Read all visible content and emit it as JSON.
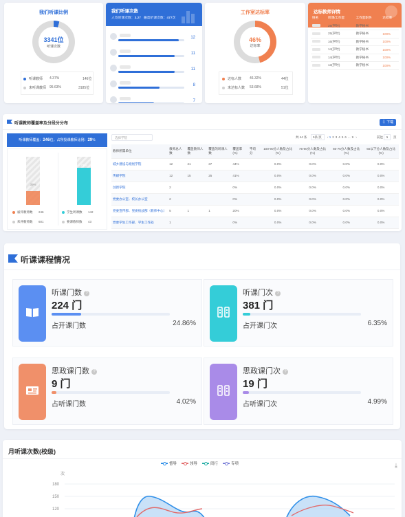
{
  "panel1": {
    "title": "我们听课比例",
    "donut_value": "3341位",
    "donut_sub": "听课次数",
    "legend": [
      {
        "label": "听课教师",
        "pct": "4.37%",
        "count": "146位",
        "color": "#2f6fd8"
      },
      {
        "label": "未听课教师",
        "pct": "95.63%",
        "count": "3185位",
        "color": "#cfcfcf"
      }
    ],
    "ratio": 0.0437
  },
  "panel2": {
    "title": "我们听课次数",
    "sub_prefix": "人均听课次数：",
    "sub_value": "3.27",
    "sub2_prefix": "最高听课次数：",
    "sub2_value": "477",
    "sub2_unit": "次",
    "rows": [
      {
        "value": "12",
        "fraction": 0.92
      },
      {
        "value": "11",
        "fraction": 0.85
      },
      {
        "value": "11",
        "fraction": 0.85
      },
      {
        "value": "8",
        "fraction": 0.62
      },
      {
        "value": "7",
        "fraction": 0.54
      }
    ]
  },
  "panel3": {
    "title": "工作室达标率",
    "donut_value": "46%",
    "donut_sub": "达标率",
    "legend": [
      {
        "label": "达标人数",
        "pct": "46.32%",
        "count": "44位",
        "color": "#f08050"
      },
      {
        "label": "未达标人数",
        "pct": "53.68%",
        "count": "51位",
        "color": "#cfcfcf"
      }
    ],
    "ratio": 0.4632
  },
  "panel4": {
    "title": "达标教师详情",
    "headers": [
      "姓名",
      "听课/工作室",
      "工作室职务",
      "达标率"
    ],
    "rows": [
      {
        "count": "25(学时)",
        "role": "教学秘书",
        "rate": "100%"
      },
      {
        "count": "25(学时)",
        "role": "教学秘书",
        "rate": "100%"
      },
      {
        "count": "16(学时)",
        "role": "教学秘书",
        "rate": "100%"
      },
      {
        "count": "14(学时)",
        "role": "教学秘书",
        "rate": "100%"
      },
      {
        "count": "14(学时)",
        "role": "教学秘书",
        "rate": "100%"
      },
      {
        "count": "13(学时)",
        "role": "教学秘书",
        "rate": "100%"
      }
    ]
  },
  "section2": {
    "title": "听课教师覆盖率及分段分分布",
    "download": "下载",
    "banner_prefix": "听课教师覆盖：",
    "banner_value1": "246",
    "banner_mid": "位，占所授课教师比例：",
    "banner_value2": "29",
    "banner_suffix": "%",
    "bar1_label": "39%",
    "bar2_label": "71%",
    "legend": [
      {
        "label": "被评教师数",
        "value": "246",
        "color": "#f08050"
      },
      {
        "label": "未评教师数",
        "value": "601",
        "color": "#cfcfcf"
      },
      {
        "label": "学生听课数",
        "value": "142",
        "color": "#34cdd8"
      },
      {
        "label": "要课教师数",
        "value": "43",
        "color": "#cfcfcf"
      }
    ],
    "search_placeholder": "选择学院",
    "pager": {
      "total": "共 44 条",
      "per_page": "5条/页",
      "pages": [
        "1",
        "2",
        "3",
        "4",
        "5",
        "6",
        "...",
        "9"
      ],
      "goto": "前往",
      "page_input": "1",
      "page_unit": "页"
    },
    "columns": [
      "教师所属单位",
      "教师总人数",
      "覆盖教师人数",
      "覆盖的听课人数",
      "覆盖率(%)",
      "平均分",
      "100-90分人数及占比(%)",
      "75-90分人数及占比(%)",
      "60-75分人数及占比(%)",
      "60以下分人数及占比(%)"
    ],
    "rows": [
      [
        "城乡建设与规划学院",
        "12",
        "21",
        "37",
        "44%",
        "",
        "0.0%",
        "0.0%",
        "0.0%",
        "0.0%"
      ],
      [
        "传媒学院",
        "12",
        "15",
        "25",
        "41%",
        "",
        "0.0%",
        "0.0%",
        "0.0%",
        "0.0%"
      ],
      [
        "创新学院",
        "2",
        "",
        "",
        "0%",
        "",
        "0.0%",
        "0.0%",
        "0.0%",
        "0.0%"
      ],
      [
        "党委办公室、校长办公室",
        "2",
        "",
        "",
        "0%",
        "",
        "0.0%",
        "0.0%",
        "0.0%",
        "0.0%"
      ],
      [
        "党委宣传部、党委统战部（教师中心）",
        "5",
        "1",
        "1",
        "20%",
        "",
        "0.0%",
        "0.0%",
        "0.0%",
        "0.0%"
      ],
      [
        "党委学生工作部、学生工作处",
        "1",
        "",
        "",
        "0%",
        "",
        "0.0%",
        "0.0%",
        "0.0%",
        "0.0%"
      ]
    ]
  },
  "section3": {
    "title": "听课课程情况",
    "cards": [
      {
        "title": "听课门数",
        "value": "224 门",
        "label": "占开课门数",
        "pct": "24.86%",
        "fraction": 0.2486,
        "color": "#5b8ff2",
        "bar": "#5b8ff2",
        "icon": "book-icon"
      },
      {
        "title": "听课门次",
        "value": "381 门",
        "label": "占开课门次",
        "pct": "6.35%",
        "fraction": 0.0635,
        "color": "#34cdd8",
        "bar": "#34cdd8",
        "icon": "columns-icon"
      },
      {
        "title": "思政课门数",
        "value": "9 门",
        "label": "占听课门数",
        "pct": "4.02%",
        "fraction": 0.0402,
        "color": "#f0906a",
        "bar": "#f0906a",
        "icon": "id-card-icon"
      },
      {
        "title": "思政课门次",
        "value": "19 门",
        "label": "占听课门次",
        "pct": "4.99%",
        "fraction": 0.0499,
        "color": "#a98be8",
        "bar": "#a98be8",
        "icon": "columns-icon"
      }
    ]
  },
  "section4": {
    "title": "月听课次数(校级)",
    "legend": [
      {
        "label": "督导",
        "color": "#2f8fe8"
      },
      {
        "label": "领导",
        "color": "#e26a6a"
      },
      {
        "label": "同行",
        "color": "#2bb0a8"
      },
      {
        "label": "专项",
        "color": "#7a7fd8"
      }
    ],
    "ylabel": "次",
    "yticks": [
      "180",
      "150",
      "120"
    ]
  }
}
